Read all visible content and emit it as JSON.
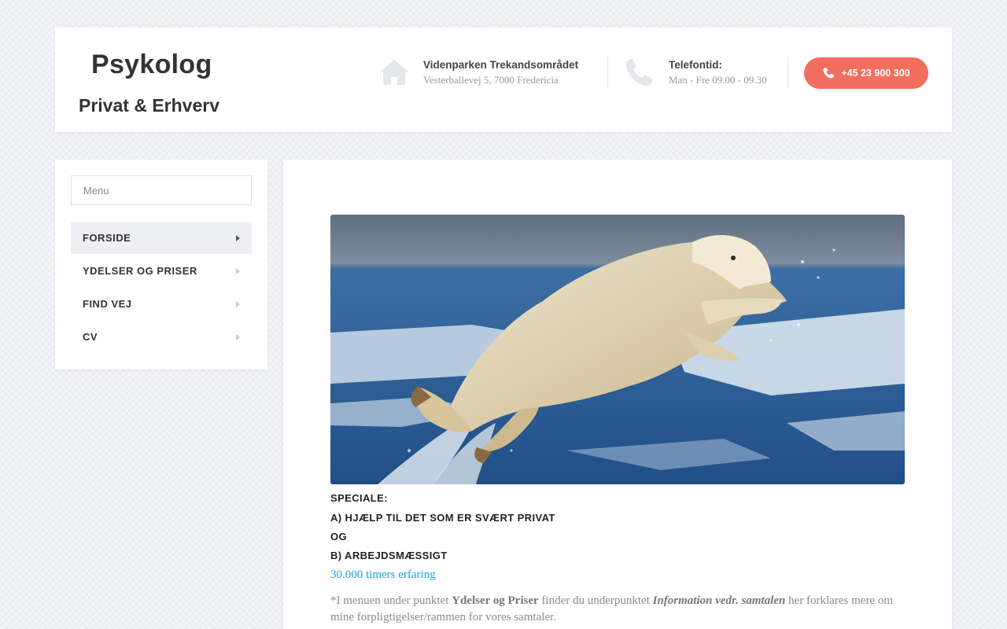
{
  "header": {
    "title": "Psykolog",
    "subtitle": "Privat & Erhverv",
    "address_label": "Videnparken Trekandsområdet",
    "address_value": "Vesterballevej 5, 7000 Fredericia",
    "phone_hours_label": "Telefontid:",
    "phone_hours_value": "Man - Fre 09.00 - 09.30",
    "phone_button_label": "+45 23 900 300",
    "icons": [
      "home-icon",
      "phone-icon",
      "phone-small-icon"
    ],
    "accent_color": "#f36e5f"
  },
  "sidebar": {
    "search_placeholder": "Menu",
    "items": [
      {
        "label": "FORSIDE",
        "active": true
      },
      {
        "label": "YDELSER OG PRISER"
      },
      {
        "label": "FIND VEJ"
      },
      {
        "label": "CV"
      }
    ]
  },
  "main": {
    "image_subject": "polar bear leaping over water",
    "specialty_heading": "SPECIALE:",
    "specialty_a": "A) HJÆLP TIL DET SOM ER SVÆRT PRIVAT",
    "specialty_og": "OG",
    "specialty_b": "B) ARBEJDSMÆSSIGT",
    "experience_link": "30.000 timers erfaring",
    "link_color": "#1fa3d6",
    "note": {
      "part1": "*I menuen under punktet ",
      "bold1": "Ydelser og Priser",
      "part2": " finder du underpunktet ",
      "italic1": "Information vedr. samtalen",
      "part3": "  her forklares mere om mine forpligtigelser/rammen for vores samtaler."
    }
  }
}
